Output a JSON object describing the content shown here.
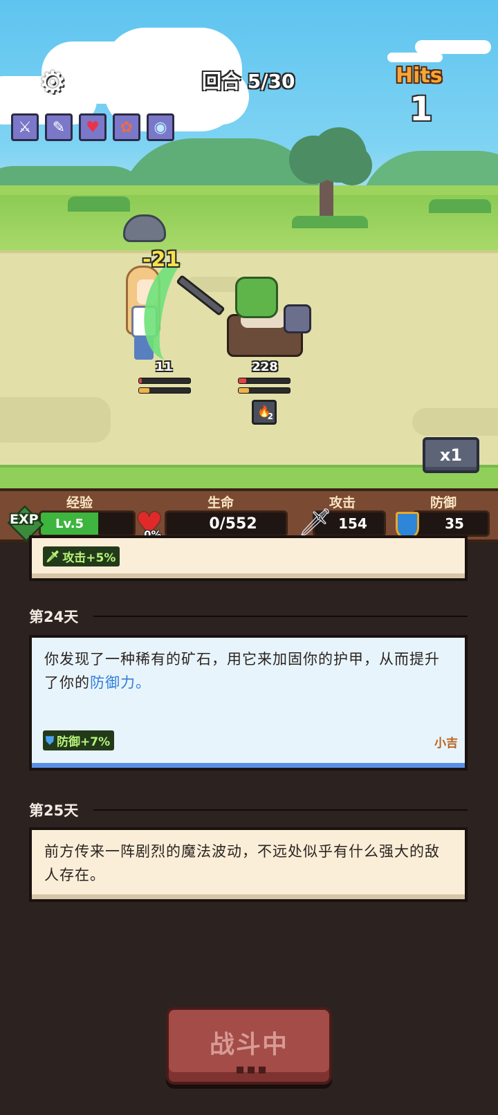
{
  "hud": {
    "round": "回合 5/30",
    "hits_label": "Hits",
    "hits_count": "1",
    "buffs": [
      "sword-buff-icon",
      "wand-buff-icon",
      "heart-buff-icon",
      "mushroom-buff-icon",
      "crystal-buff-icon"
    ]
  },
  "battle": {
    "damage_popup": "-21",
    "hero_hp": "11",
    "hero_hp_fraction": 0.05,
    "enemy_hp": "228",
    "enemy_hp_fraction": 0.15,
    "enemy_status_count": "2",
    "speed": "x1"
  },
  "stats": {
    "exp_label": "经验",
    "exp_badge": "EXP",
    "level": "Lv.5",
    "exp_fraction": 0.62,
    "life_label": "生命",
    "life_percent": "0%",
    "life_value": "0/552",
    "attack_label": "攻击",
    "attack_value": "154",
    "defense_label": "防御",
    "defense_value": "35"
  },
  "log": {
    "card_prev_tag": "攻击+5%",
    "day24_label": "第24天",
    "day24_text_a": "你发现了一种稀有的矿石，用它来加固你的护甲，从而提升了你的",
    "day24_text_highlight": "防御力。",
    "day24_tag": "防御+7%",
    "day24_rarity": "小吉",
    "day25_label": "第25天",
    "day25_text": "前方传来一阵剧烈的魔法波动，不远处似乎有什么强大的敌人存在。"
  },
  "action": {
    "fight_label": "战斗中"
  },
  "colors": {
    "path": "#e2dfa9",
    "grass": "#8fcf5a",
    "panel_brown": "#7a4a33",
    "log_bg": "#2c2220",
    "highlight_blue": "#2f7ed8",
    "button_red": "#a34c48"
  }
}
